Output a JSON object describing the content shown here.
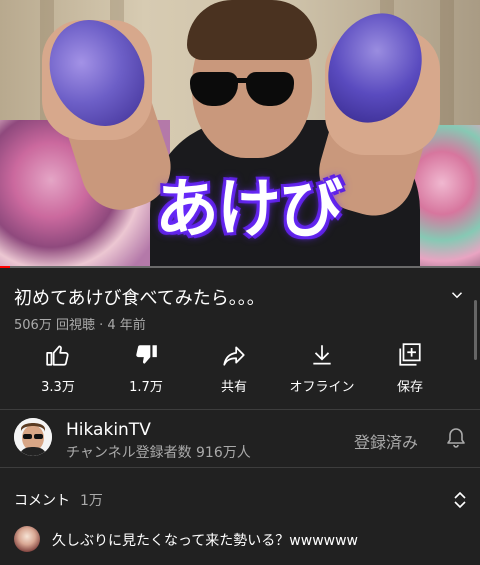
{
  "video": {
    "overlay_caption": "あけび",
    "progress_fraction": 0.02
  },
  "title": "初めてあけび食べてみたら。。。",
  "meta": "506万 回視聴 · 4 年前",
  "actions": [
    {
      "label": "3.3万",
      "icon": "thumbs-up-icon"
    },
    {
      "label": "1.7万",
      "icon": "thumbs-down-icon"
    },
    {
      "label": "共有",
      "icon": "share-icon"
    },
    {
      "label": "オフライン",
      "icon": "download-icon"
    },
    {
      "label": "保存",
      "icon": "save-playlist-icon"
    }
  ],
  "channel": {
    "name": "HikakinTV",
    "subscribers": "チャンネル登録者数 916万人",
    "subscribe_state": "登録済み"
  },
  "comments": {
    "label": "コメント",
    "count": "1万",
    "top_comment": "久しぶりに見たくなって来た勢いる？wwwwww"
  },
  "colors": {
    "background": "#212121",
    "progress": "#ff0000",
    "caption_glow": "#6a2cff"
  }
}
